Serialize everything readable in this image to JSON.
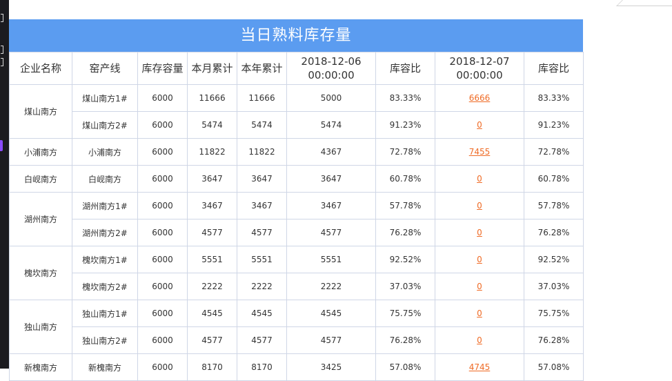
{
  "report": {
    "title": "当日熟料库存量",
    "headers": [
      "企业名称",
      "窑产线",
      "库存容量",
      "本月累计",
      "本年累计",
      "2018-12-06\n00:00:00",
      "库容比",
      "2018-12-07\n00:00:00",
      "库容比"
    ],
    "groups": [
      {
        "company": "煤山南方",
        "lines": [
          {
            "line": "煤山南方1#",
            "capacity": "6000",
            "month": "11666",
            "year": "11666",
            "d1": "5000",
            "r1": "83.33%",
            "d2": "6666",
            "r2": "83.33%"
          },
          {
            "line": "煤山南方2#",
            "capacity": "6000",
            "month": "5474",
            "year": "5474",
            "d1": "5474",
            "r1": "91.23%",
            "d2": "0",
            "r2": "91.23%"
          }
        ]
      },
      {
        "company": "小浦南方",
        "lines": [
          {
            "line": "小浦南方",
            "capacity": "6000",
            "month": "11822",
            "year": "11822",
            "d1": "4367",
            "r1": "72.78%",
            "d2": "7455",
            "r2": "72.78%"
          }
        ]
      },
      {
        "company": "白岘南方",
        "lines": [
          {
            "line": "白岘南方",
            "capacity": "6000",
            "month": "3647",
            "year": "3647",
            "d1": "3647",
            "r1": "60.78%",
            "d2": "0",
            "r2": "60.78%"
          }
        ]
      },
      {
        "company": "湖州南方",
        "lines": [
          {
            "line": "湖州南方1#",
            "capacity": "6000",
            "month": "3467",
            "year": "3467",
            "d1": "3467",
            "r1": "57.78%",
            "d2": "0",
            "r2": "57.78%"
          },
          {
            "line": "湖州南方2#",
            "capacity": "6000",
            "month": "4577",
            "year": "4577",
            "d1": "4577",
            "r1": "76.28%",
            "d2": "0",
            "r2": "76.28%"
          }
        ]
      },
      {
        "company": "槐坎南方",
        "lines": [
          {
            "line": "槐坎南方1#",
            "capacity": "6000",
            "month": "5551",
            "year": "5551",
            "d1": "5551",
            "r1": "92.52%",
            "d2": "0",
            "r2": "92.52%"
          },
          {
            "line": "槐坎南方2#",
            "capacity": "6000",
            "month": "2222",
            "year": "2222",
            "d1": "2222",
            "r1": "37.03%",
            "d2": "0",
            "r2": "37.03%"
          }
        ]
      },
      {
        "company": "独山南方",
        "lines": [
          {
            "line": "独山南方1#",
            "capacity": "6000",
            "month": "4545",
            "year": "4545",
            "d1": "4545",
            "r1": "75.75%",
            "d2": "0",
            "r2": "75.75%"
          },
          {
            "line": "独山南方2#",
            "capacity": "6000",
            "month": "4577",
            "year": "4577",
            "d1": "4577",
            "r1": "76.28%",
            "d2": "0",
            "r2": "76.28%"
          }
        ]
      },
      {
        "company": "新槐南方",
        "lines": [
          {
            "line": "新槐南方",
            "capacity": "6000",
            "month": "8170",
            "year": "8170",
            "d1": "3425",
            "r1": "57.08%",
            "d2": "4745",
            "r2": "57.08%"
          }
        ]
      }
    ]
  },
  "colors": {
    "title_bar": "#5b9cf0",
    "link": "#ef6a24",
    "border": "#cfd6e6"
  }
}
